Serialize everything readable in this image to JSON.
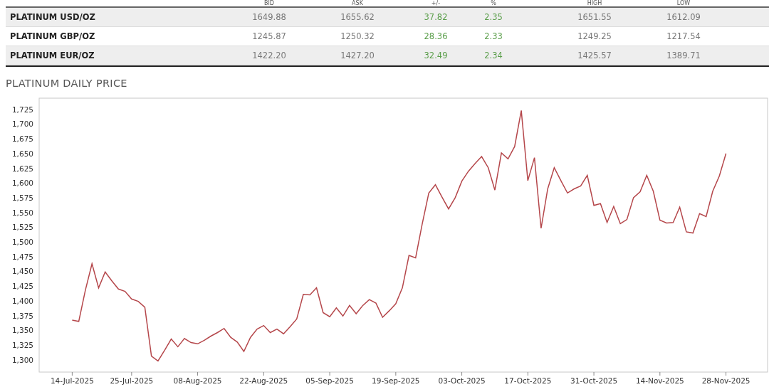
{
  "table": {
    "columns": [
      "BID",
      "ASK",
      "+/-",
      "%",
      "HIGH",
      "LOW"
    ],
    "rows": [
      {
        "name": "PLATINUM USD/OZ",
        "cells": [
          "1649.88",
          "1655.62",
          "37.82",
          "2.35",
          "1651.55",
          "1612.09"
        ]
      },
      {
        "name": "PLATINUM GBP/OZ",
        "cells": [
          "1245.87",
          "1250.32",
          "28.36",
          "2.33",
          "1249.25",
          "1217.54"
        ]
      },
      {
        "name": "PLATINUM EUR/OZ",
        "cells": [
          "1422.20",
          "1427.20",
          "32.49",
          "2.34",
          "1425.57",
          "1389.71"
        ]
      }
    ]
  },
  "chart": {
    "title": "PLATINUM DAILY PRICE",
    "chart_data": {
      "type": "line",
      "ylim": [
        1279,
        1744
      ],
      "yticks": [
        {
          "value": 1300,
          "label": "1,300"
        },
        {
          "value": 1325,
          "label": "1,325"
        },
        {
          "value": 1350,
          "label": "1,350"
        },
        {
          "value": 1375,
          "label": "1,375"
        },
        {
          "value": 1400,
          "label": "1,400"
        },
        {
          "value": 1425,
          "label": "1,425"
        },
        {
          "value": 1450,
          "label": "1,450"
        },
        {
          "value": 1475,
          "label": "1,475"
        },
        {
          "value": 1500,
          "label": "1,500"
        },
        {
          "value": 1525,
          "label": "1,525"
        },
        {
          "value": 1550,
          "label": "1,550"
        },
        {
          "value": 1575,
          "label": "1,575"
        },
        {
          "value": 1600,
          "label": "1,600"
        },
        {
          "value": 1625,
          "label": "1,625"
        },
        {
          "value": 1650,
          "label": "1,650"
        },
        {
          "value": 1675,
          "label": "1,675"
        },
        {
          "value": 1700,
          "label": "1,700"
        },
        {
          "value": 1725,
          "label": "1,725"
        }
      ],
      "categories": [
        "14-Jul-2025",
        null,
        null,
        null,
        null,
        null,
        null,
        null,
        null,
        "25-Jul-2025",
        null,
        null,
        null,
        null,
        null,
        null,
        null,
        null,
        null,
        "08-Aug-2025",
        null,
        null,
        null,
        null,
        null,
        null,
        null,
        null,
        null,
        "22-Aug-2025",
        null,
        null,
        null,
        null,
        null,
        null,
        null,
        null,
        null,
        "05-Sep-2025",
        null,
        null,
        null,
        null,
        null,
        null,
        null,
        null,
        null,
        "19-Sep-2025",
        null,
        null,
        null,
        null,
        null,
        null,
        null,
        null,
        null,
        "03-Oct-2025",
        null,
        null,
        null,
        null,
        null,
        null,
        null,
        null,
        null,
        "17-Oct-2025",
        null,
        null,
        null,
        null,
        null,
        null,
        null,
        null,
        null,
        "31-Oct-2025",
        null,
        null,
        null,
        null,
        null,
        null,
        null,
        null,
        null,
        "14-Nov-2025",
        null,
        null,
        null,
        null,
        null,
        null,
        null,
        null,
        null,
        "28-Nov-2025"
      ],
      "series": [
        {
          "color": "#b5474b",
          "values": [
            1367,
            1365,
            1418,
            1463,
            1422,
            1449,
            1434,
            1420,
            1416,
            1403,
            1399,
            1389,
            1306,
            1298,
            1316,
            1335,
            1322,
            1336,
            1329,
            1327,
            1333,
            1340,
            1346,
            1353,
            1338,
            1330,
            1314,
            1338,
            1352,
            1358,
            1346,
            1352,
            1344,
            1356,
            1369,
            1411,
            1410,
            1422,
            1380,
            1373,
            1388,
            1374,
            1392,
            1378,
            1392,
            1402,
            1396,
            1372,
            1383,
            1395,
            1422,
            1477,
            1473,
            1530,
            1583,
            1597,
            1576,
            1556,
            1575,
            1603,
            1620,
            1633,
            1645,
            1626,
            1588,
            1651,
            1641,
            1662,
            1723,
            1604,
            1643,
            1523,
            1590,
            1626,
            1604,
            1583,
            1590,
            1595,
            1613,
            1562,
            1565,
            1533,
            1560,
            1531,
            1538,
            1575,
            1585,
            1613,
            1586,
            1537,
            1532,
            1533,
            1559,
            1517,
            1515,
            1548,
            1543,
            1586,
            1612,
            1650
          ]
        }
      ]
    }
  }
}
